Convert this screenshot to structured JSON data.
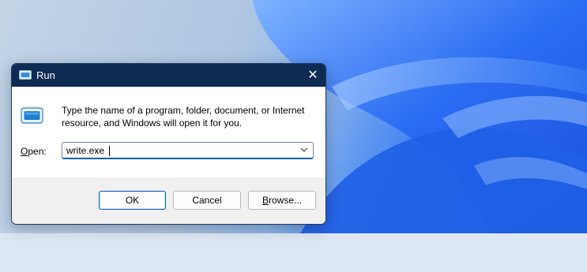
{
  "dialog": {
    "title": "Run",
    "close_glyph": "✕",
    "description": "Type the name of a program, folder, document, or Internet resource, and Windows will open it for you.",
    "open_label_prefix": "",
    "open_label_underlined": "O",
    "open_label_rest": "pen:",
    "input_value": "write.exe",
    "buttons": {
      "ok": "OK",
      "cancel": "Cancel",
      "browse_underlined": "B",
      "browse_rest": "rowse..."
    }
  },
  "icons": {
    "title": "run-app-icon",
    "close": "close-icon",
    "body": "run-program-icon",
    "dropdown": "chevron-down-icon"
  },
  "colors": {
    "titlebar": "#0d2b53",
    "accent": "#0b5cc0",
    "wallpaper_blue": "#2d6ff0"
  }
}
